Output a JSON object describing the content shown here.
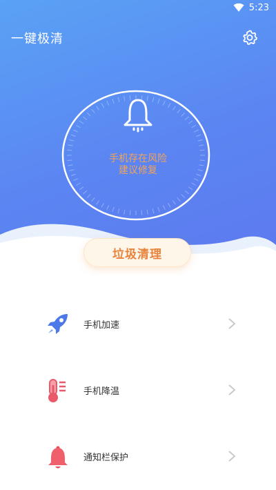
{
  "status_bar": {
    "time": "5:23"
  },
  "header": {
    "title": "一键极清"
  },
  "dial": {
    "status_line1": "手机存在风险",
    "status_line2": "建议修复"
  },
  "clean_button": {
    "label": "垃圾清理"
  },
  "features": [
    {
      "label": "手机加速",
      "icon": "rocket-icon"
    },
    {
      "label": "手机降温",
      "icon": "thermometer-icon"
    },
    {
      "label": "通知栏保护",
      "icon": "bell-icon"
    }
  ],
  "colors": {
    "hero_top": "#5aa2f5",
    "hero_bottom": "#5c79ee",
    "accent_orange": "#f0a35a",
    "button_text": "#e8833d"
  }
}
